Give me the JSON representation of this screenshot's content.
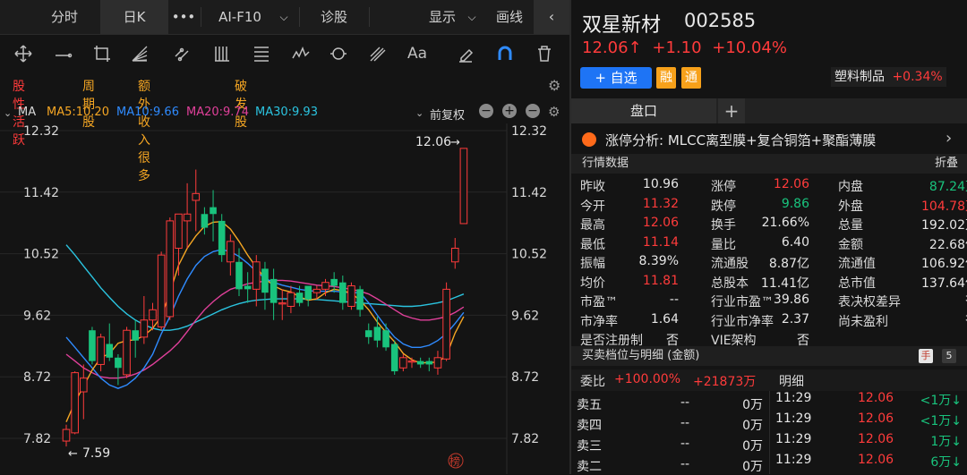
{
  "tabs": {
    "time": "分时",
    "dayk": "日K",
    "more": "•••",
    "ai": "AI-F10",
    "diag": "诊股",
    "display": "显示",
    "draw": "画线"
  },
  "tags": [
    "股性活跃",
    "周期股",
    "额外收入很多",
    "破发股"
  ],
  "ma": {
    "label": "MA",
    "ma5": "MA5:10.20",
    "ma10": "MA10:9.66",
    "ma20": "MA20:9.74",
    "ma30": "MA30:9.93",
    "adjust": "前复权"
  },
  "colors": {
    "ma5": "#f5a623",
    "ma10": "#2f8bff",
    "ma20": "#e0409a",
    "ma30": "#2bc4e0",
    "up": "#ff3b3b",
    "down": "#19c37d"
  },
  "axis": {
    "left": [
      "12.32",
      "11.42",
      "10.52",
      "9.62",
      "8.72",
      "7.82"
    ],
    "right": [
      "12.32",
      "11.42",
      "10.52",
      "9.62",
      "8.72",
      "7.82"
    ]
  },
  "annotations": {
    "high": "12.06",
    "low": "7.59",
    "bang": "榜"
  },
  "chart_data": {
    "type": "candlestick",
    "ylim": [
      7.6,
      12.4
    ],
    "candles": [
      [
        7.78,
        7.95,
        7.7,
        8.02
      ],
      [
        7.9,
        8.78,
        7.88,
        8.8
      ],
      [
        8.5,
        8.7,
        8.1,
        8.9
      ],
      [
        9.4,
        8.95,
        8.9,
        9.45
      ],
      [
        8.9,
        9.3,
        8.8,
        9.35
      ],
      [
        9.2,
        9.0,
        8.95,
        9.5
      ],
      [
        9.0,
        8.85,
        8.6,
        9.05
      ],
      [
        8.75,
        9.4,
        8.7,
        9.45
      ],
      [
        9.4,
        9.25,
        9.0,
        9.55
      ],
      [
        9.3,
        9.55,
        9.2,
        9.9
      ],
      [
        9.55,
        9.7,
        9.4,
        9.8
      ],
      [
        9.45,
        10.5,
        9.4,
        10.55
      ],
      [
        9.6,
        11.0,
        9.55,
        11.05
      ],
      [
        10.6,
        11.1,
        10.2,
        11.1
      ],
      [
        11.0,
        11.1,
        10.6,
        11.55
      ],
      [
        11.3,
        11.4,
        10.85,
        11.75
      ],
      [
        11.1,
        10.9,
        10.8,
        11.2
      ],
      [
        11.2,
        11.1,
        10.7,
        11.45
      ],
      [
        11.0,
        10.5,
        10.4,
        11.1
      ],
      [
        10.4,
        10.7,
        10.2,
        10.8
      ],
      [
        10.4,
        10.0,
        9.9,
        10.6
      ],
      [
        10.05,
        10.0,
        9.8,
        10.25
      ],
      [
        10.0,
        10.4,
        9.75,
        10.5
      ],
      [
        10.3,
        9.95,
        9.7,
        10.4
      ],
      [
        10.15,
        9.8,
        9.55,
        10.3
      ],
      [
        9.8,
        9.8,
        9.55,
        10.0
      ],
      [
        9.75,
        9.95,
        9.65,
        10.05
      ],
      [
        9.95,
        9.8,
        9.75,
        10.05
      ],
      [
        10.05,
        9.85,
        9.75,
        10.05
      ],
      [
        9.95,
        10.0,
        9.85,
        10.05
      ],
      [
        10.0,
        10.1,
        9.9,
        10.15
      ],
      [
        10.15,
        10.05,
        9.95,
        10.25
      ],
      [
        10.1,
        9.8,
        9.7,
        10.2
      ],
      [
        9.75,
        10.05,
        9.7,
        10.1
      ],
      [
        10.0,
        9.7,
        9.6,
        10.05
      ],
      [
        9.4,
        9.3,
        9.2,
        9.5
      ],
      [
        9.45,
        9.25,
        9.15,
        9.6
      ],
      [
        9.4,
        9.15,
        9.1,
        9.5
      ],
      [
        9.2,
        8.8,
        8.75,
        9.25
      ],
      [
        8.85,
        9.0,
        8.8,
        9.05
      ],
      [
        8.95,
        8.95,
        8.85,
        9.0
      ],
      [
        8.95,
        8.9,
        8.85,
        9.0
      ],
      [
        8.95,
        8.9,
        8.8,
        9.0
      ],
      [
        8.85,
        9.0,
        8.75,
        9.1
      ],
      [
        8.98,
        10.0,
        8.95,
        10.1
      ],
      [
        10.4,
        10.6,
        10.3,
        10.75
      ],
      [
        10.96,
        12.06,
        10.96,
        12.06
      ]
    ],
    "ma5": [
      8.06,
      8.35,
      8.58,
      8.82,
      9.0,
      9.06,
      9.21,
      9.25,
      9.26,
      9.32,
      9.43,
      9.6,
      9.95,
      10.35,
      10.6,
      10.78,
      10.92,
      10.98,
      10.99,
      10.88,
      10.7,
      10.5,
      10.32,
      10.16,
      10.05,
      9.99,
      9.96,
      9.89,
      9.84,
      9.86,
      9.95,
      10.0,
      9.98,
      9.94,
      9.84,
      9.7,
      9.52,
      9.37,
      9.23,
      9.06,
      8.97,
      8.92,
      8.93,
      8.93,
      9.03,
      9.36,
      9.6
    ],
    "ma10": [
      9.3,
      9.15,
      9.0,
      8.85,
      8.7,
      8.6,
      8.55,
      8.6,
      8.7,
      8.85,
      9.05,
      9.35,
      9.6,
      9.9,
      10.15,
      10.35,
      10.48,
      10.55,
      10.58,
      10.55,
      10.48,
      10.38,
      10.26,
      10.16,
      10.1,
      10.06,
      10.03,
      10.0,
      9.98,
      9.97,
      9.97,
      9.97,
      9.96,
      9.95,
      9.95,
      9.8,
      9.62,
      9.45,
      9.3,
      9.2,
      9.15,
      9.15,
      9.18,
      9.25,
      9.35,
      9.5,
      9.66
    ],
    "ma20": [
      9.05,
      8.95,
      8.85,
      8.78,
      8.72,
      8.7,
      8.7,
      8.72,
      8.76,
      8.82,
      8.9,
      9.0,
      9.1,
      9.22,
      9.38,
      9.55,
      9.7,
      9.82,
      9.92,
      10.0,
      10.04,
      10.08,
      10.1,
      10.12,
      10.13,
      10.13,
      10.12,
      10.1,
      10.08,
      10.06,
      10.05,
      10.04,
      10.02,
      10.0,
      9.97,
      9.93,
      9.86,
      9.78,
      9.7,
      9.62,
      9.58,
      9.55,
      9.55,
      9.57,
      9.6,
      9.66,
      9.74
    ],
    "ma30": [
      10.65,
      10.5,
      10.34,
      10.18,
      10.02,
      9.88,
      9.75,
      9.64,
      9.55,
      9.48,
      9.43,
      9.4,
      9.4,
      9.42,
      9.46,
      9.52,
      9.58,
      9.64,
      9.7,
      9.75,
      9.79,
      9.82,
      9.84,
      9.85,
      9.86,
      9.86,
      9.86,
      9.86,
      9.85,
      9.85,
      9.84,
      9.83,
      9.82,
      9.81,
      9.8,
      9.79,
      9.78,
      9.77,
      9.76,
      9.75,
      9.75,
      9.76,
      9.78,
      9.8,
      9.83,
      9.88,
      9.93
    ]
  },
  "stock": {
    "name": "双星新材",
    "code": "002585",
    "price": "12.06",
    "arrow": "↑",
    "change": "+1.10",
    "pct": "+10.04%"
  },
  "buttons": {
    "fav": "+ 自选",
    "rong": "融",
    "tong": "通"
  },
  "sector": {
    "name": "塑料制品",
    "pct": "+0.34%"
  },
  "panel_tabs": {
    "tab": "盘口",
    "add": "+"
  },
  "limitup": {
    "label": "涨停分析: MLCC离型膜+复合铜箔+聚酯薄膜",
    "more": "›"
  },
  "quote_head": {
    "title": "行情数据",
    "fold": "折叠"
  },
  "quote": [
    [
      [
        "昨收",
        "10.96",
        "white"
      ],
      [
        "涨停",
        "12.06",
        "red"
      ],
      [
        "内盘",
        "87.24万",
        "green"
      ]
    ],
    [
      [
        "今开",
        "11.32",
        "red"
      ],
      [
        "跌停",
        "9.86",
        "green"
      ],
      [
        "外盘",
        "104.78万",
        "red"
      ]
    ],
    [
      [
        "最高",
        "12.06",
        "red"
      ],
      [
        "换手",
        "21.66%",
        "white"
      ],
      [
        "总量",
        "192.02万",
        "white"
      ]
    ],
    [
      [
        "最低",
        "11.14",
        "red"
      ],
      [
        "量比",
        "6.40",
        "white"
      ],
      [
        "金额",
        "22.68亿",
        "white"
      ]
    ],
    [
      [
        "振幅",
        "8.39%",
        "white"
      ],
      [
        "流通股",
        "8.87亿",
        "white"
      ],
      [
        "流通值",
        "106.92亿",
        "white"
      ]
    ],
    [
      [
        "均价",
        "11.81",
        "red"
      ],
      [
        "总股本",
        "11.41亿",
        "white"
      ],
      [
        "总市值",
        "137.64亿",
        "white"
      ]
    ],
    [
      [
        "市盈™",
        "--",
        "white"
      ],
      [
        "行业市盈™",
        "39.86",
        "white"
      ],
      [
        "表决权差异",
        "否",
        "white"
      ]
    ],
    [
      [
        "市净率",
        "1.64",
        "white"
      ],
      [
        "行业市净率",
        "2.37",
        "white"
      ],
      [
        "尚未盈利",
        "否",
        "white"
      ]
    ],
    [
      [
        "是否注册制",
        "否",
        "white"
      ],
      [
        "VIE架构",
        "否",
        "white"
      ],
      [
        "",
        "",
        " white"
      ]
    ]
  ],
  "orderbook_head": {
    "title": "买卖档位与明细 (金额)",
    "hand": "手",
    "five": "5"
  },
  "weibi": {
    "label": "委比",
    "pct": "+100.00%",
    "amt": "+21873万"
  },
  "detail_label": "明细",
  "asks": [
    [
      "卖五",
      "--",
      "0万"
    ],
    [
      "卖四",
      "--",
      "0万"
    ],
    [
      "卖三",
      "--",
      "0万"
    ],
    [
      "卖二",
      "--",
      "0万"
    ]
  ],
  "details": [
    [
      "11:29",
      "12.06",
      "<1万↓"
    ],
    [
      "11:29",
      "12.06",
      "<1万↓"
    ],
    [
      "11:29",
      "12.06",
      "1万↓"
    ],
    [
      "11:29",
      "12.06",
      "6万↓"
    ]
  ]
}
